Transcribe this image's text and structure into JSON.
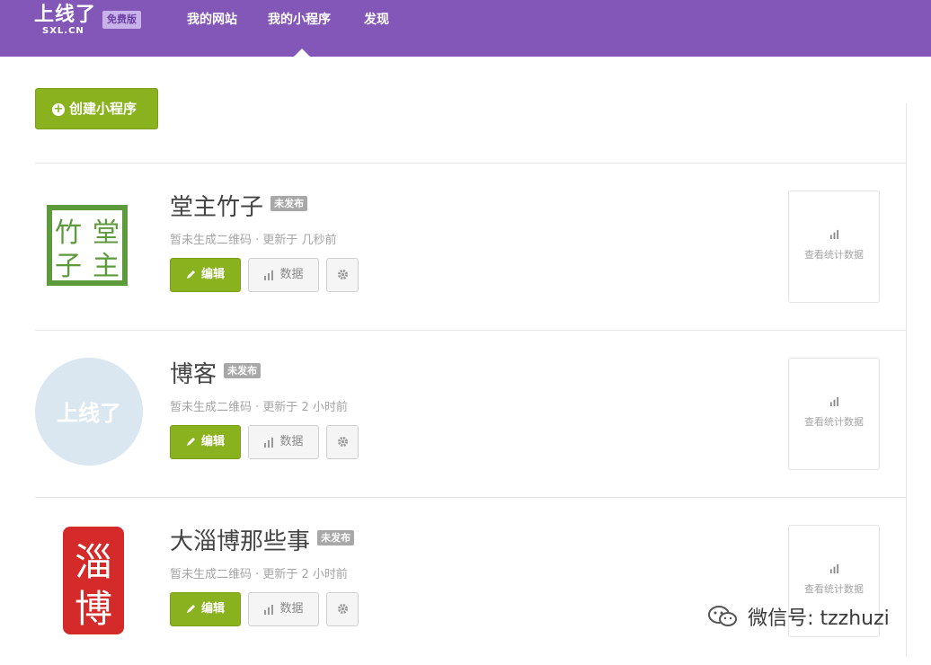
{
  "header": {
    "logo_text": "上线了",
    "logo_subtext": "SXL.CN",
    "plan_badge": "免费版",
    "nav": [
      "我的网站",
      "我的小程序",
      "发现"
    ]
  },
  "toolbar": {
    "create_label": "创建小程序"
  },
  "apps": [
    {
      "title": "堂主竹子",
      "status": "未发布",
      "meta": "暂未生成二维码 · 更新于 几秒前",
      "thumb_chars": [
        "竹",
        "堂",
        "子",
        "主"
      ],
      "edit_label": "编辑",
      "data_label": "数据",
      "stats_label": "查看统计数据"
    },
    {
      "title": "博客",
      "status": "未发布",
      "meta": "暂未生成二维码 · 更新于 2 小时前",
      "thumb_chars": [
        "上线了"
      ],
      "edit_label": "编辑",
      "data_label": "数据",
      "stats_label": "查看统计数据"
    },
    {
      "title": "大淄博那些事",
      "status": "未发布",
      "meta": "暂未生成二维码 · 更新于 2 小时前",
      "thumb_chars": [
        "淄",
        "博"
      ],
      "edit_label": "编辑",
      "data_label": "数据",
      "stats_label": "查看统计数据"
    }
  ],
  "watermark": {
    "text": "微信号: tzzhuzi"
  },
  "colors": {
    "header": "#8357b8",
    "accent_green": "#8ab21e",
    "badge_gray": "#a8a8a8",
    "seal_red": "#d42a2a",
    "seal_green": "#5c9a3c"
  },
  "icons": {
    "plus": "plus-circle-icon",
    "edit": "pencil-icon",
    "data": "bar-chart-icon",
    "settings": "gear-icon",
    "stats": "bar-chart-icon",
    "watermark": "wechat-icon"
  }
}
